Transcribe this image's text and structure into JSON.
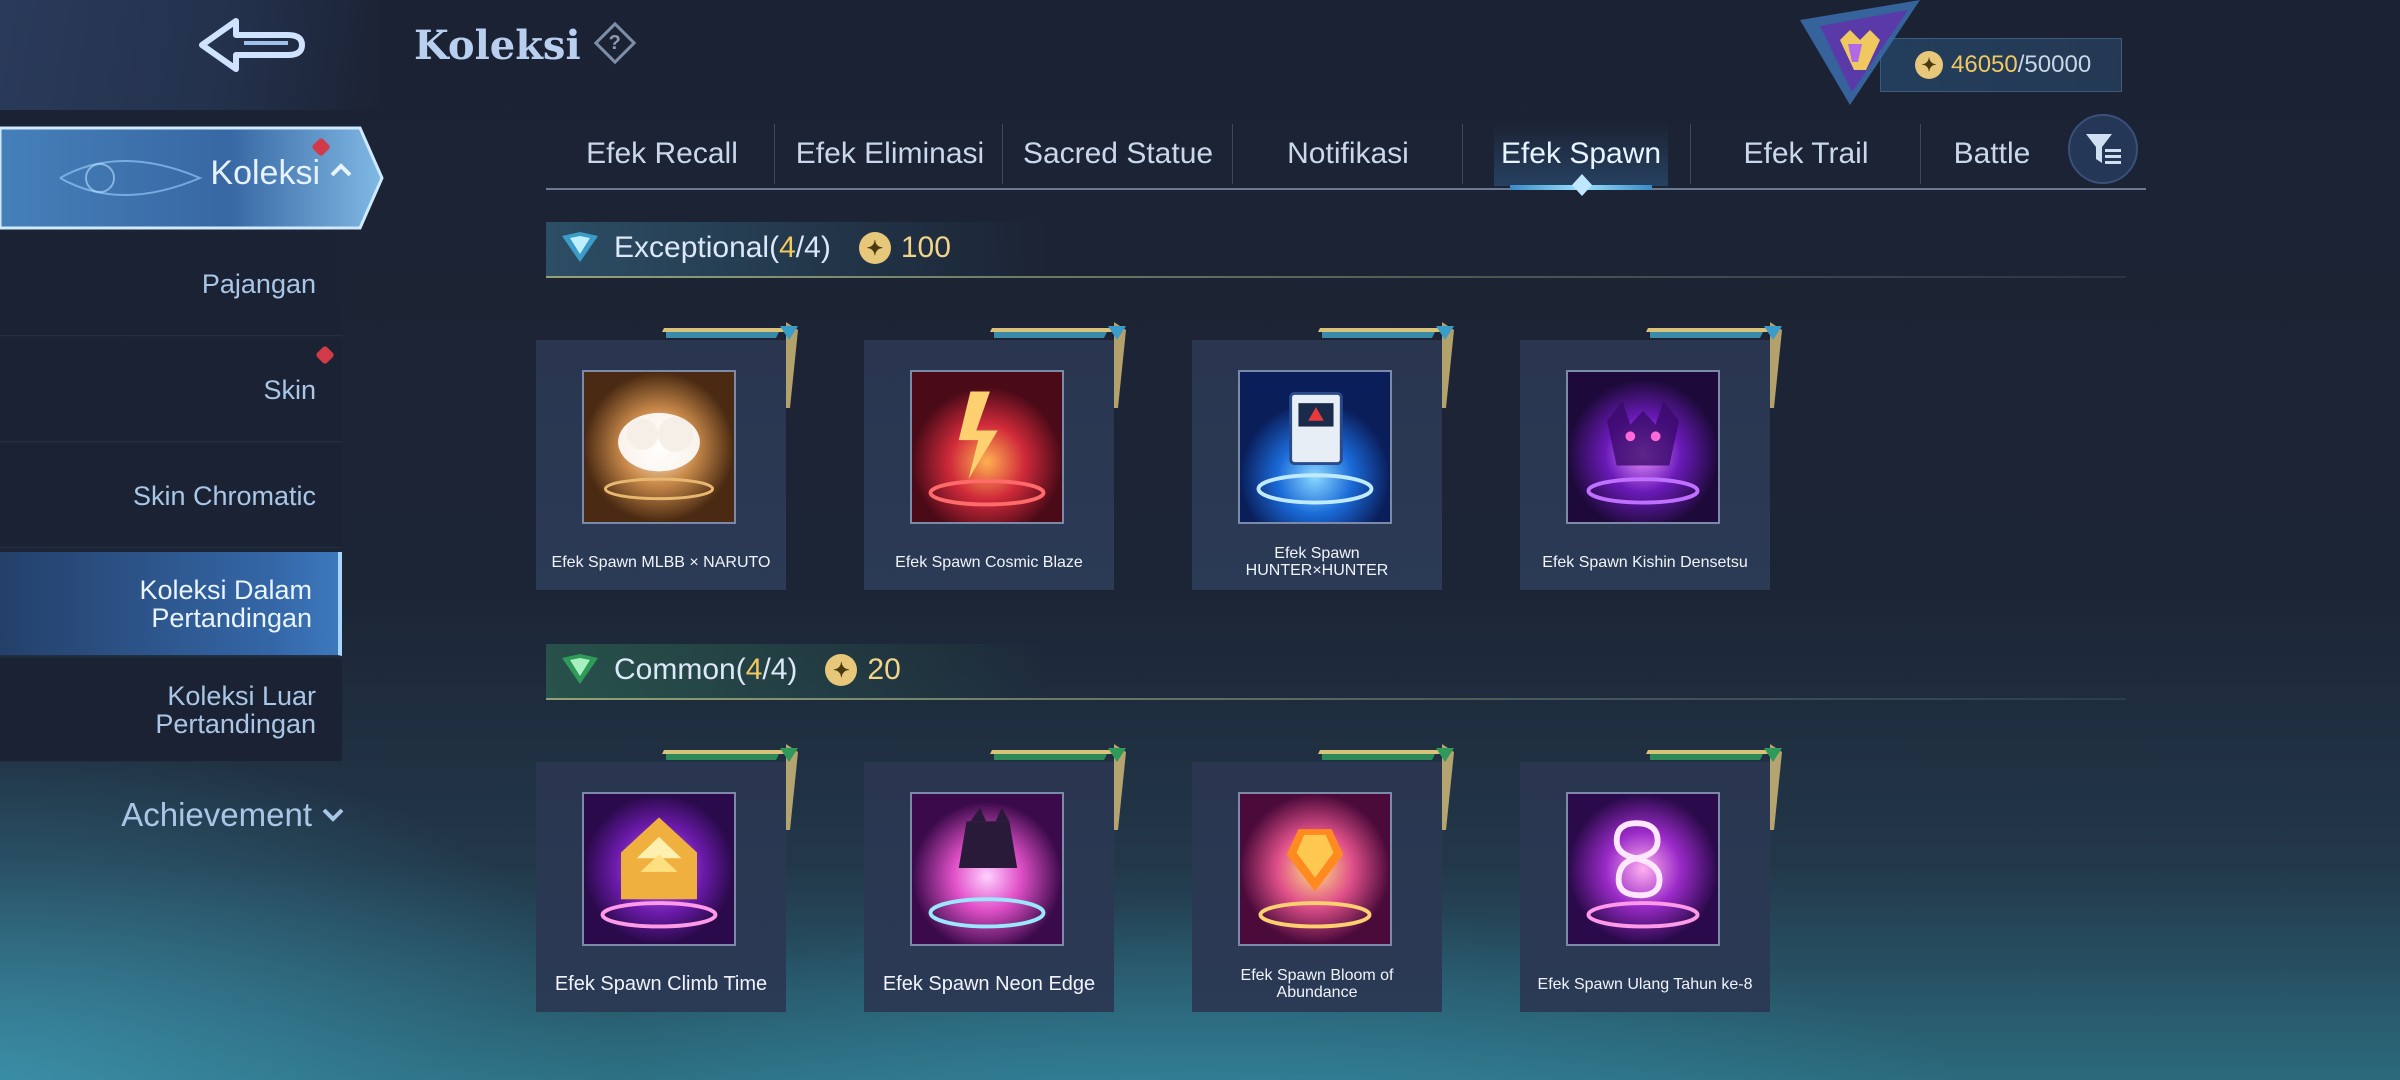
{
  "header": {
    "title": "Koleksi",
    "help": "?",
    "points_current": "46050",
    "points_sep": "/",
    "points_max": "50000"
  },
  "sidebar": {
    "active": {
      "label": "Koleksi",
      "badge": true
    },
    "items": [
      {
        "label": "Pajangan",
        "badge": false,
        "active": false
      },
      {
        "label": "Skin",
        "badge": true,
        "active": false
      },
      {
        "label": "Skin Chromatic",
        "badge": false,
        "active": false
      },
      {
        "label": "Koleksi Dalam Pertandingan",
        "badge": false,
        "active": true
      },
      {
        "label": "Koleksi Luar Pertandingan",
        "badge": false,
        "active": false
      }
    ],
    "achievement": "Achievement"
  },
  "tabs": [
    {
      "label": "Efek Recall",
      "active": false
    },
    {
      "label": "Efek Eliminasi",
      "active": false
    },
    {
      "label": "Sacred Statue",
      "active": false
    },
    {
      "label": "Notifikasi",
      "active": false
    },
    {
      "label": "Efek Spawn",
      "active": true
    },
    {
      "label": "Efek Trail",
      "active": false
    },
    {
      "label": "Battle",
      "active": false
    }
  ],
  "sections": {
    "exceptional": {
      "title": "Exceptional",
      "open": "(",
      "count": "4",
      "slash": "/",
      "total": "4",
      "close": ")",
      "points": "100",
      "items": [
        {
          "name": "Efek Spawn MLBB × NARUTO",
          "art": "naruto"
        },
        {
          "name": "Efek Spawn Cosmic Blaze",
          "art": "cosmic"
        },
        {
          "name": "Efek Spawn HUNTER×HUNTER",
          "art": "hunter"
        },
        {
          "name": "Efek Spawn Kishin Densetsu",
          "art": "kishin"
        }
      ]
    },
    "common": {
      "title": "Common",
      "open": "(",
      "count": "4",
      "slash": "/",
      "total": "4",
      "close": ")",
      "points": "20",
      "items": [
        {
          "name": "Efek Spawn Climb Time",
          "art": "climb"
        },
        {
          "name": "Efek Spawn Neon Edge",
          "art": "neon"
        },
        {
          "name": "Efek Spawn Bloom of Abundance",
          "art": "bloom"
        },
        {
          "name": "Efek Spawn Ulang Tahun ke-8",
          "art": "bday"
        }
      ]
    }
  },
  "colors": {
    "accent_gold": "#f0c860",
    "exceptional_ribbon": "#3a8aa8",
    "common_ribbon": "#2f8a5a"
  }
}
